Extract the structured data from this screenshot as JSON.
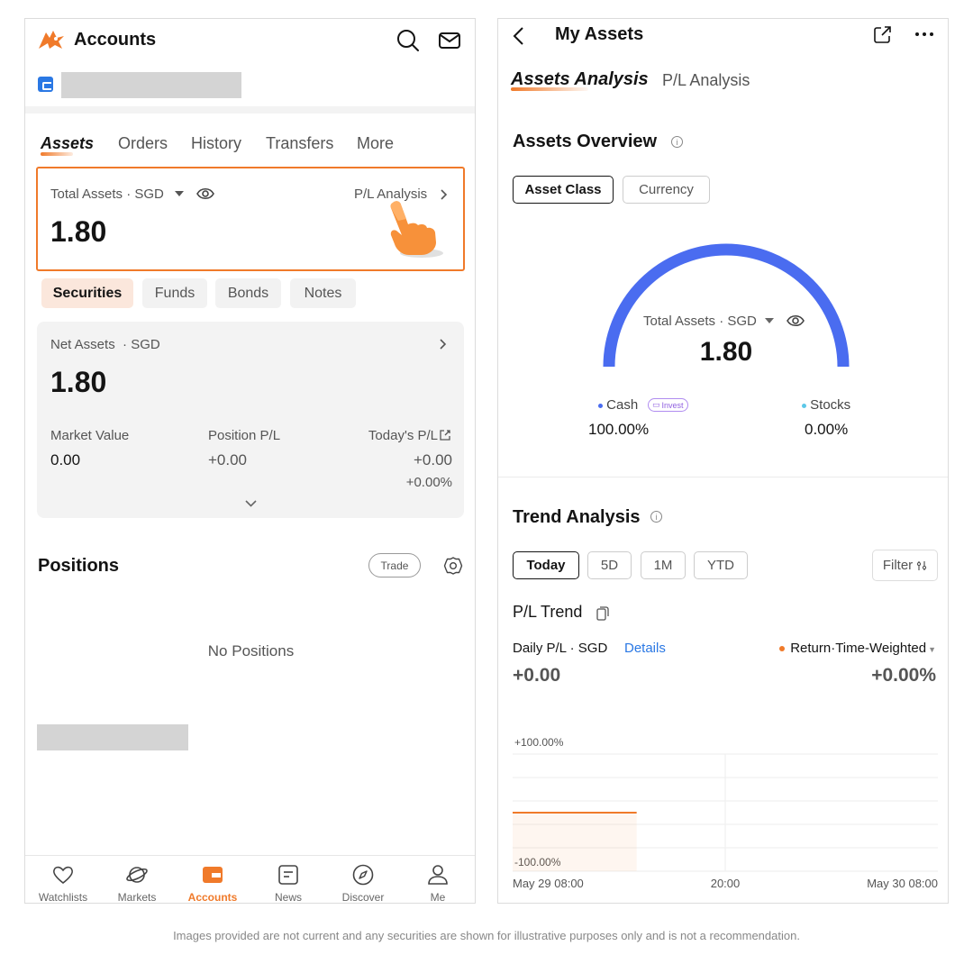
{
  "left": {
    "header": {
      "title": "Accounts"
    },
    "tabs": [
      "Assets",
      "Orders",
      "History",
      "Transfers",
      "More"
    ],
    "total_assets": {
      "label": "Total Assets",
      "currency": "· SGD",
      "pl_link": "P/L Analysis",
      "value": "1.80"
    },
    "chips": [
      "Securities",
      "Funds",
      "Bonds",
      "Notes"
    ],
    "net_assets": {
      "label": "Net Assets",
      "currency": "· SGD",
      "value": "1.80",
      "market_value_label": "Market Value",
      "market_value": "0.00",
      "position_pl_label": "Position P/L",
      "position_pl": "+0.00",
      "todays_pl_label": "Today's P/L",
      "todays_pl": "+0.00",
      "todays_pl_pct": "+0.00%"
    },
    "positions": {
      "title": "Positions",
      "trade_label": "Trade",
      "empty_text": "No Positions"
    },
    "bottom_nav": [
      {
        "label": "Watchlists",
        "icon": "heart-icon"
      },
      {
        "label": "Markets",
        "icon": "planet-icon"
      },
      {
        "label": "Accounts",
        "icon": "wallet-icon"
      },
      {
        "label": "News",
        "icon": "news-icon"
      },
      {
        "label": "Discover",
        "icon": "compass-icon"
      },
      {
        "label": "Me",
        "icon": "person-icon"
      }
    ]
  },
  "right": {
    "header": {
      "title": "My Assets"
    },
    "tabs": [
      "Assets Analysis",
      "P/L Analysis"
    ],
    "overview": {
      "title": "Assets Overview",
      "segments": [
        "Asset Class",
        "Currency"
      ],
      "gauge_label": "Total Assets · SGD",
      "gauge_value": "1.80",
      "cash_label": "Cash",
      "cash_badge": "Invest",
      "cash_pct": "100.00%",
      "stocks_label": "Stocks",
      "stocks_pct": "0.00%"
    },
    "trend": {
      "title": "Trend Analysis",
      "periods": [
        "Today",
        "5D",
        "1M",
        "YTD"
      ],
      "filter_label": "Filter",
      "pl_trend_label": "P/L Trend",
      "daily_pl_label": "Daily P/L · SGD",
      "details_label": "Details",
      "daily_pl_value": "+0.00",
      "return_label": "Return·Time-Weighted",
      "return_value": "+0.00%"
    }
  },
  "chart_data": {
    "type": "line",
    "title": "",
    "xlabel": "",
    "ylabel": "",
    "x_ticks": [
      "May 29 08:00",
      "20:00",
      "May 30 08:00"
    ],
    "y_ticks": [
      "+100.00%",
      "-100.00%"
    ],
    "ylim": [
      -100,
      100
    ],
    "x_range": [
      "May 29 08:00",
      "May 30 08:00"
    ],
    "series": [
      {
        "name": "Return·Time-Weighted",
        "x": [
          "May 29 08:00",
          "May 29 15:00"
        ],
        "y": [
          0,
          0
        ]
      }
    ],
    "grid": true,
    "colors": {
      "line": "#f07a2a"
    }
  },
  "disclaimer": "Images provided are not current and any securities are shown for illustrative purposes only and is not a recommendation.",
  "colors": {
    "accent": "#f07a2a",
    "gauge": "#4a6cf0",
    "link": "#2a78e4"
  }
}
